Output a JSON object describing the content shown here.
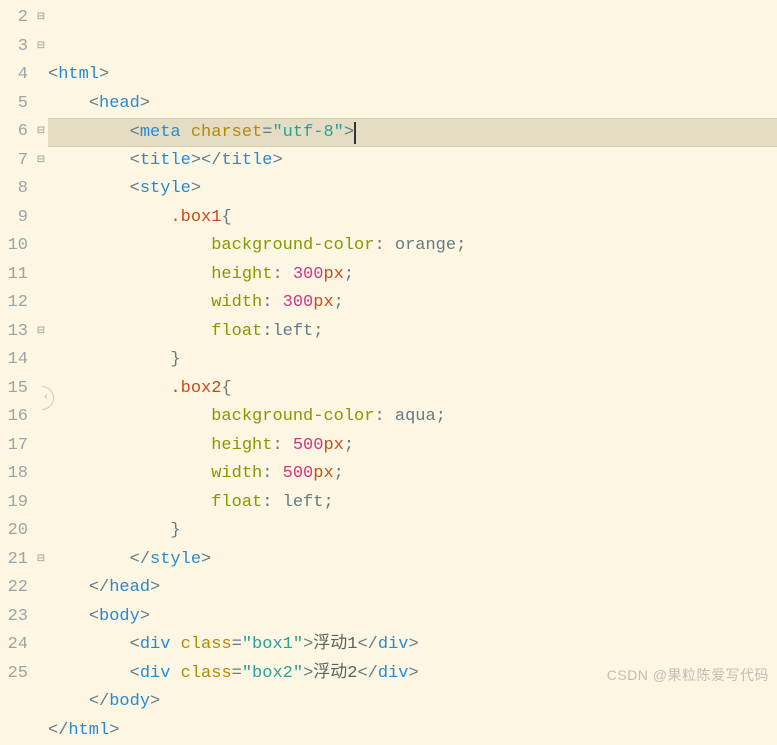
{
  "watermark": "CSDN @果粒陈爱写代码",
  "lines": [
    {
      "n": 2,
      "fold": "⊟",
      "hl": false,
      "tokens": [
        [
          "t-bracket",
          "<"
        ],
        [
          "t-tag",
          "html"
        ],
        [
          "t-bracket",
          ">"
        ]
      ]
    },
    {
      "n": 3,
      "fold": "⊟",
      "hl": false,
      "indent": 1,
      "tokens": [
        [
          "t-bracket",
          "<"
        ],
        [
          "t-tag",
          "head"
        ],
        [
          "t-bracket",
          ">"
        ]
      ]
    },
    {
      "n": 4,
      "fold": "",
      "hl": true,
      "indent": 2,
      "caretAfter": true,
      "tokens": [
        [
          "t-bracket",
          "<"
        ],
        [
          "t-tag",
          "meta"
        ],
        [
          "t-text",
          " "
        ],
        [
          "t-attr",
          "charset"
        ],
        [
          "t-punct",
          "="
        ],
        [
          "t-str",
          "\"utf-8\""
        ],
        [
          "t-bracket",
          ">"
        ]
      ]
    },
    {
      "n": 5,
      "fold": "",
      "hl": false,
      "indent": 2,
      "tokens": [
        [
          "t-bracket",
          "<"
        ],
        [
          "t-tag",
          "title"
        ],
        [
          "t-bracket",
          ">"
        ],
        [
          "t-bracket",
          "</"
        ],
        [
          "t-tag",
          "title"
        ],
        [
          "t-bracket",
          ">"
        ]
      ]
    },
    {
      "n": 6,
      "fold": "⊟",
      "hl": false,
      "indent": 2,
      "tokens": [
        [
          "t-bracket",
          "<"
        ],
        [
          "t-tag",
          "style"
        ],
        [
          "t-bracket",
          ">"
        ]
      ]
    },
    {
      "n": 7,
      "fold": "⊟",
      "hl": false,
      "indent": 3,
      "tokens": [
        [
          "t-sel",
          ".box1"
        ],
        [
          "t-punct",
          "{"
        ]
      ]
    },
    {
      "n": 8,
      "fold": "",
      "hl": false,
      "indent": 4,
      "tokens": [
        [
          "t-prop",
          "background-color"
        ],
        [
          "t-punct",
          ": "
        ],
        [
          "t-val",
          "orange"
        ],
        [
          "t-punct",
          ";"
        ]
      ]
    },
    {
      "n": 9,
      "fold": "",
      "hl": false,
      "indent": 4,
      "tokens": [
        [
          "t-prop",
          "height"
        ],
        [
          "t-punct",
          ": "
        ],
        [
          "t-num",
          "300"
        ],
        [
          "t-unit",
          "px"
        ],
        [
          "t-punct",
          ";"
        ]
      ]
    },
    {
      "n": 10,
      "fold": "",
      "hl": false,
      "indent": 4,
      "tokens": [
        [
          "t-prop",
          "width"
        ],
        [
          "t-punct",
          ": "
        ],
        [
          "t-num",
          "300"
        ],
        [
          "t-unit",
          "px"
        ],
        [
          "t-punct",
          ";"
        ]
      ]
    },
    {
      "n": 11,
      "fold": "",
      "hl": false,
      "indent": 4,
      "tokens": [
        [
          "t-prop",
          "float"
        ],
        [
          "t-punct",
          ":"
        ],
        [
          "t-val",
          "left"
        ],
        [
          "t-punct",
          ";"
        ]
      ]
    },
    {
      "n": 12,
      "fold": "",
      "hl": false,
      "indent": 3,
      "tokens": [
        [
          "t-punct",
          "}"
        ]
      ]
    },
    {
      "n": 13,
      "fold": "⊟",
      "hl": false,
      "indent": 3,
      "tokens": [
        [
          "t-sel",
          ".box2"
        ],
        [
          "t-punct",
          "{"
        ]
      ]
    },
    {
      "n": 14,
      "fold": "",
      "hl": false,
      "indent": 4,
      "tokens": [
        [
          "t-prop",
          "background-color"
        ],
        [
          "t-punct",
          ": "
        ],
        [
          "t-val",
          "aqua"
        ],
        [
          "t-punct",
          ";"
        ]
      ]
    },
    {
      "n": 15,
      "fold": "",
      "hl": false,
      "indent": 4,
      "tokens": [
        [
          "t-prop",
          "height"
        ],
        [
          "t-punct",
          ": "
        ],
        [
          "t-num",
          "500"
        ],
        [
          "t-unit",
          "px"
        ],
        [
          "t-punct",
          ";"
        ]
      ]
    },
    {
      "n": 16,
      "fold": "",
      "hl": false,
      "indent": 4,
      "tokens": [
        [
          "t-prop",
          "width"
        ],
        [
          "t-punct",
          ": "
        ],
        [
          "t-num",
          "500"
        ],
        [
          "t-unit",
          "px"
        ],
        [
          "t-punct",
          ";"
        ]
      ]
    },
    {
      "n": 17,
      "fold": "",
      "hl": false,
      "indent": 4,
      "tokens": [
        [
          "t-prop",
          "float"
        ],
        [
          "t-punct",
          ": "
        ],
        [
          "t-val",
          "left"
        ],
        [
          "t-punct",
          ";"
        ]
      ]
    },
    {
      "n": 18,
      "fold": "",
      "hl": false,
      "indent": 3,
      "tokens": [
        [
          "t-punct",
          "}"
        ]
      ]
    },
    {
      "n": 19,
      "fold": "",
      "hl": false,
      "indent": 2,
      "tokens": [
        [
          "t-bracket",
          "</"
        ],
        [
          "t-tag",
          "style"
        ],
        [
          "t-bracket",
          ">"
        ]
      ]
    },
    {
      "n": 20,
      "fold": "",
      "hl": false,
      "indent": 1,
      "tokens": [
        [
          "t-bracket",
          "</"
        ],
        [
          "t-tag",
          "head"
        ],
        [
          "t-bracket",
          ">"
        ]
      ]
    },
    {
      "n": 21,
      "fold": "⊟",
      "hl": false,
      "indent": 1,
      "tokens": [
        [
          "t-bracket",
          "<"
        ],
        [
          "t-tag",
          "body"
        ],
        [
          "t-bracket",
          ">"
        ]
      ]
    },
    {
      "n": 22,
      "fold": "",
      "hl": false,
      "indent": 2,
      "tokens": [
        [
          "t-bracket",
          "<"
        ],
        [
          "t-tag",
          "div"
        ],
        [
          "t-text",
          " "
        ],
        [
          "t-attr",
          "class"
        ],
        [
          "t-punct",
          "="
        ],
        [
          "t-str",
          "\"box1\""
        ],
        [
          "t-bracket",
          ">"
        ],
        [
          "t-text",
          "浮动1"
        ],
        [
          "t-bracket",
          "</"
        ],
        [
          "t-tag",
          "div"
        ],
        [
          "t-bracket",
          ">"
        ]
      ]
    },
    {
      "n": 23,
      "fold": "",
      "hl": false,
      "indent": 2,
      "tokens": [
        [
          "t-bracket",
          "<"
        ],
        [
          "t-tag",
          "div"
        ],
        [
          "t-text",
          " "
        ],
        [
          "t-attr",
          "class"
        ],
        [
          "t-punct",
          "="
        ],
        [
          "t-str",
          "\"box2\""
        ],
        [
          "t-bracket",
          ">"
        ],
        [
          "t-text",
          "浮动2"
        ],
        [
          "t-bracket",
          "</"
        ],
        [
          "t-tag",
          "div"
        ],
        [
          "t-bracket",
          ">"
        ]
      ]
    },
    {
      "n": 24,
      "fold": "",
      "hl": false,
      "indent": 1,
      "tokens": [
        [
          "t-bracket",
          "</"
        ],
        [
          "t-tag",
          "body"
        ],
        [
          "t-bracket",
          ">"
        ]
      ]
    },
    {
      "n": 25,
      "fold": "",
      "hl": false,
      "indent": 0,
      "tokens": [
        [
          "t-bracket",
          "</"
        ],
        [
          "t-tag",
          "html"
        ],
        [
          "t-bracket",
          ">"
        ]
      ]
    }
  ]
}
